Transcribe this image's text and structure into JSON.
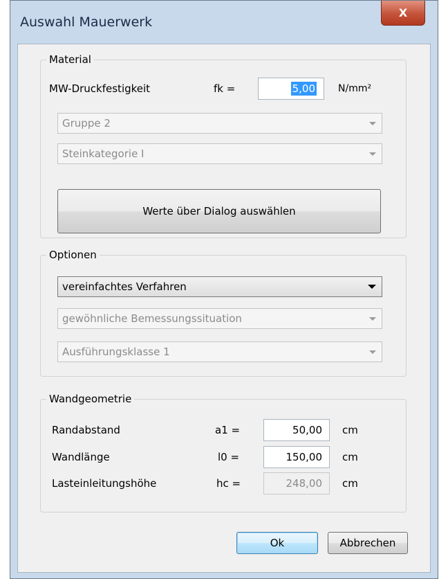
{
  "window": {
    "title": "Auswahl Mauerwerk",
    "close_glyph": "X"
  },
  "material": {
    "legend": "Material",
    "strength_label": "MW-Druckfestigkeit",
    "strength_symbol": "fk =",
    "strength_value": "5,00",
    "strength_unit": "N/mm²",
    "group_combo": "Gruppe 2",
    "category_combo": "Steinkategorie I",
    "dialog_button": "Werte über Dialog auswählen"
  },
  "options": {
    "legend": "Optionen",
    "method_combo": "vereinfachtes Verfahren",
    "situation_combo": "gewöhnliche Bemessungssituation",
    "class_combo": "Ausführungsklasse 1"
  },
  "geometry": {
    "legend": "Wandgeometrie",
    "rows": [
      {
        "label": "Randabstand",
        "symbol": "a1 =",
        "value": "50,00",
        "unit": "cm"
      },
      {
        "label": "Wandlänge",
        "symbol": "l0 =",
        "value": "150,00",
        "unit": "cm"
      },
      {
        "label": "Lasteinleitungshöhe",
        "symbol": "hc =",
        "value": "248,00",
        "unit": "cm"
      }
    ]
  },
  "buttons": {
    "ok": "Ok",
    "cancel": "Abbrechen"
  }
}
